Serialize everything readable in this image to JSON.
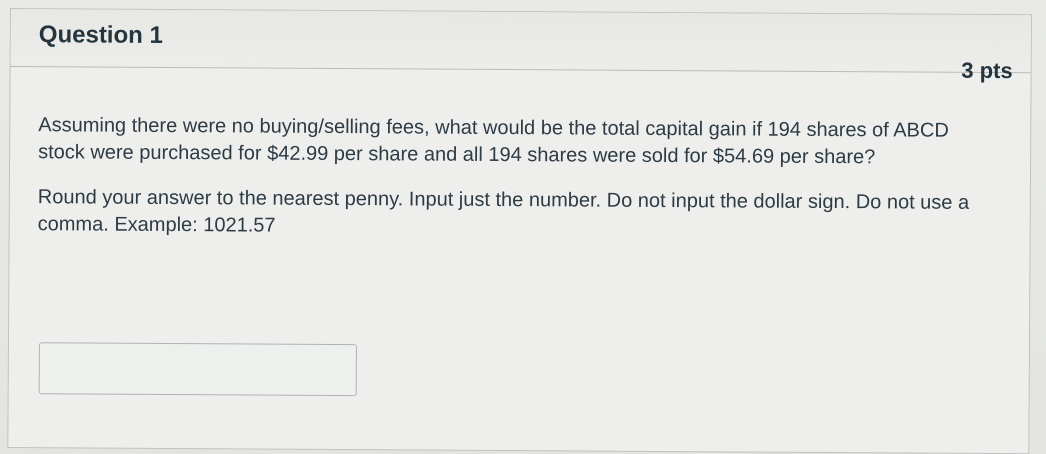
{
  "question": {
    "title": "Question 1",
    "points": "3 pts",
    "prompt": "Assuming there were no buying/selling fees, what would be the total capital gain if 194 shares of ABCD stock were purchased for $42.99 per share and all 194 shares were sold  for $54.69 per share?",
    "instructions": "Round your answer to the nearest penny.  Input just the number.  Do not input the dollar sign.  Do not use a comma.  Example: 1021.57",
    "answer_value": ""
  }
}
